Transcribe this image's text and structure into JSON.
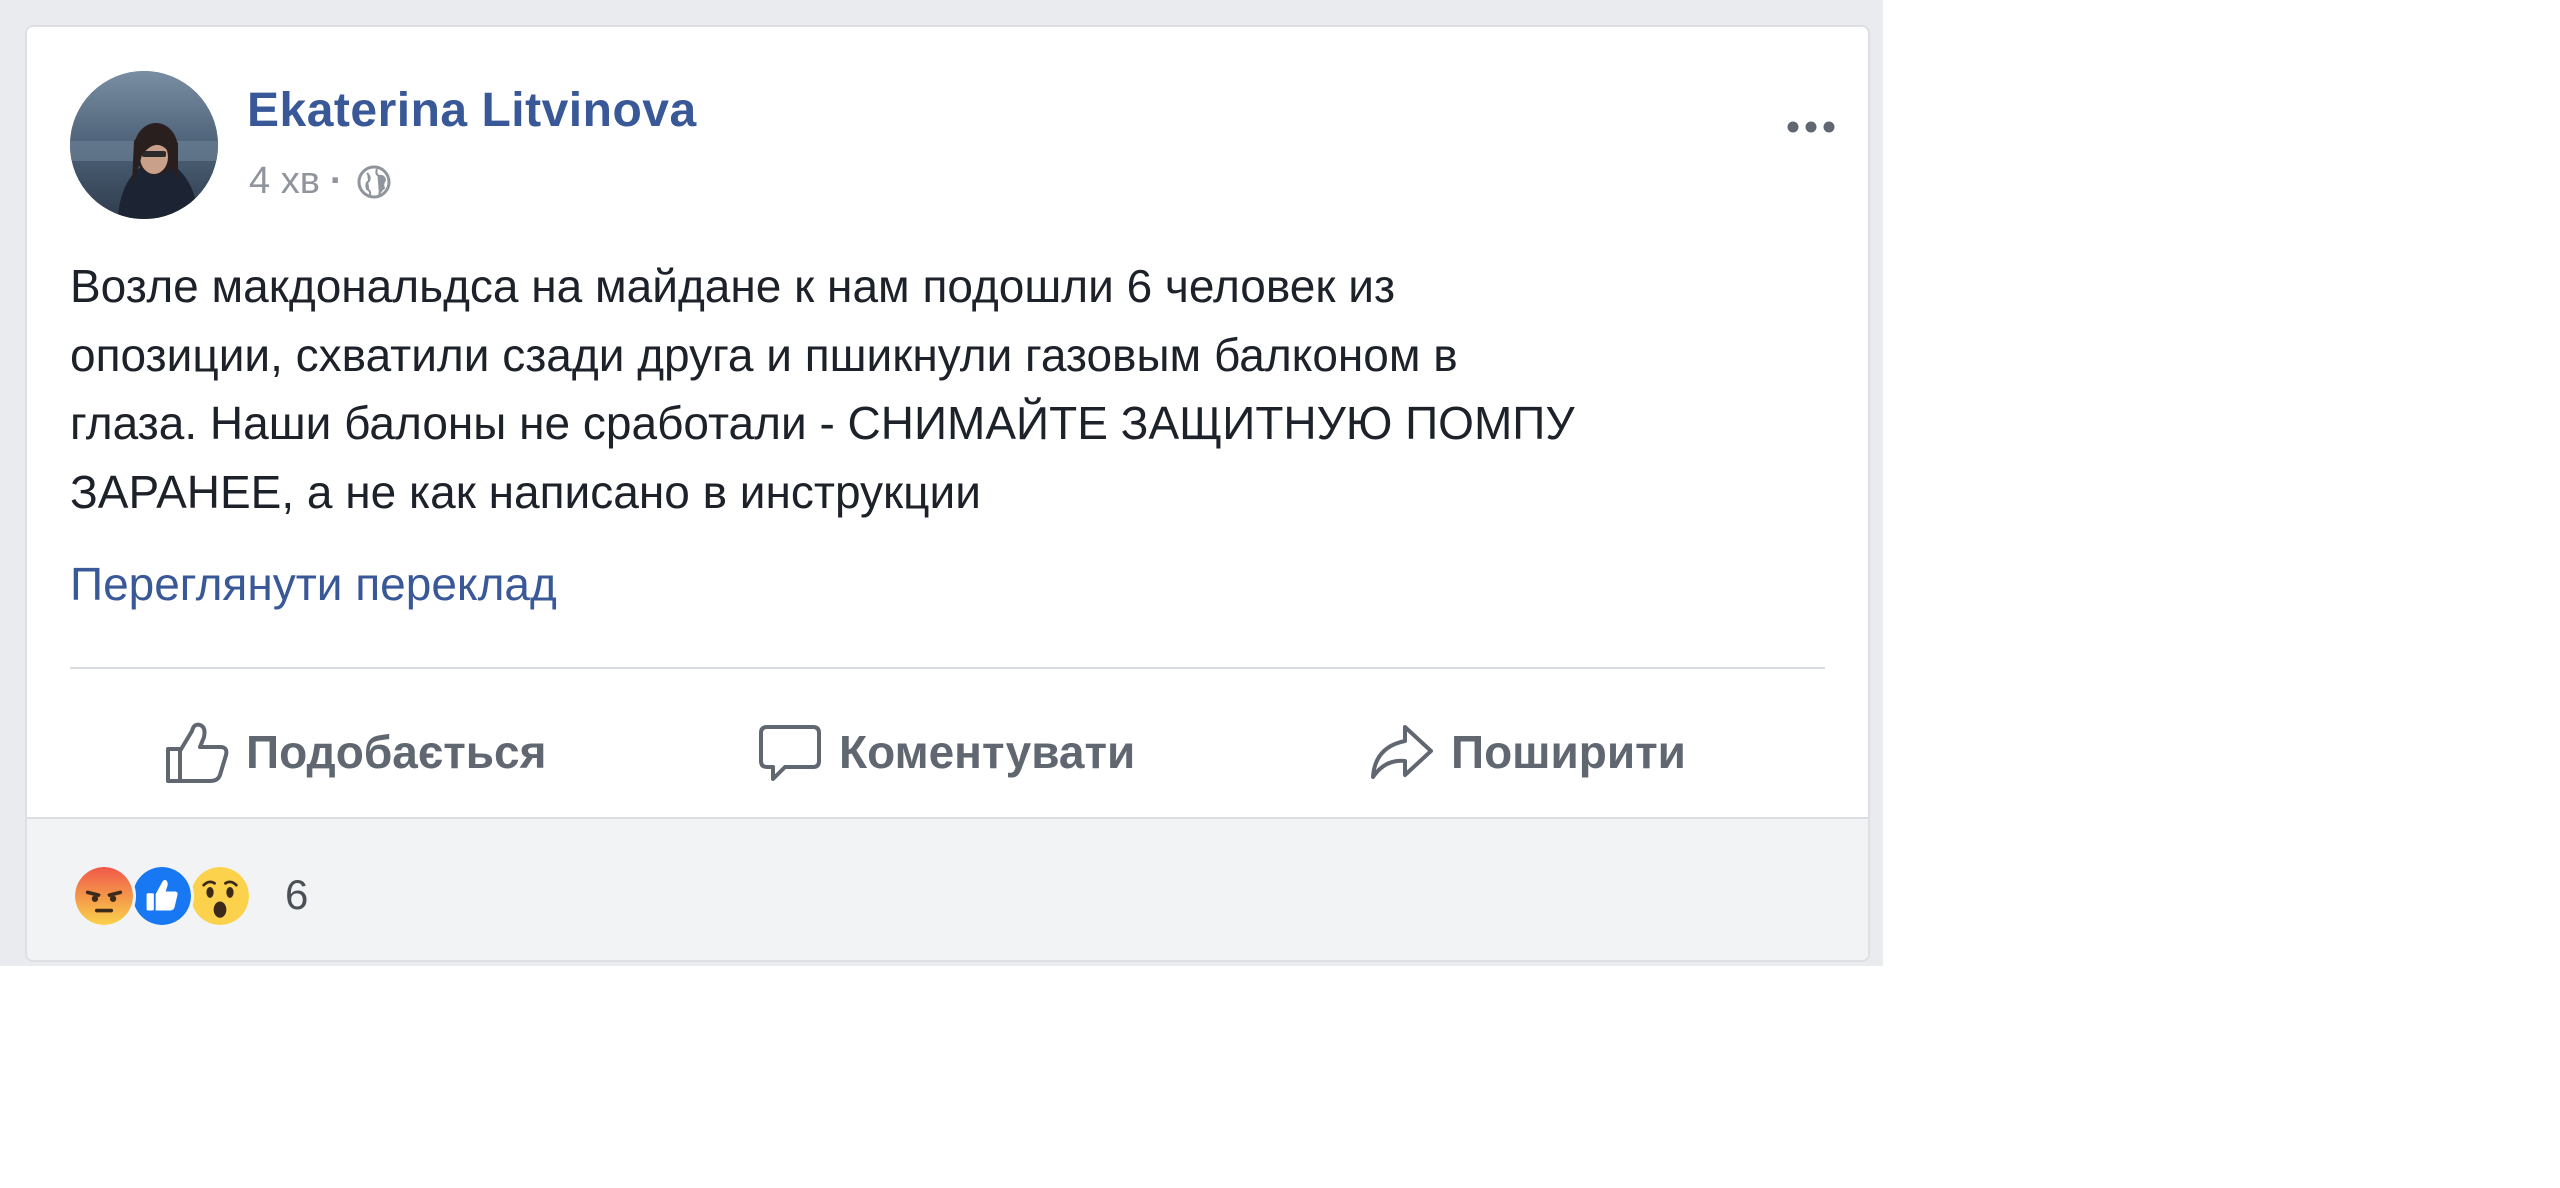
{
  "post": {
    "author": "Ekaterina Litvinova",
    "time": "4 хв",
    "separator": "·",
    "privacy_icon": "globe-icon",
    "more_icon": "more-options-icon",
    "text_lines": [
      "Возле макдональдса на майдане к нам подошли 6 человек из",
      "опозиции, схватили сзади друга и пшикнули газовым балконом в",
      "глаза. Наши балоны не сработали - СНИМАЙТЕ ЗАЩИТНУЮ ПОМПУ",
      "ЗАРАНЕЕ, а не как написано в инструкции"
    ],
    "translate_link": "Переглянути переклад"
  },
  "actions": {
    "like": {
      "label": "Подобається",
      "icon": "thumbs-up-icon"
    },
    "comment": {
      "label": "Коментувати",
      "icon": "comment-bubble-icon"
    },
    "share": {
      "label": "Поширити",
      "icon": "share-arrow-icon"
    }
  },
  "reactions": {
    "icons": [
      "angry-reaction-icon",
      "like-reaction-icon",
      "wow-reaction-icon"
    ],
    "count": "6"
  },
  "colors": {
    "link_blue": "#385898",
    "text": "#1d2129",
    "muted": "#90949c",
    "action_gray": "#606770",
    "feed_background": "#e9ebee"
  }
}
